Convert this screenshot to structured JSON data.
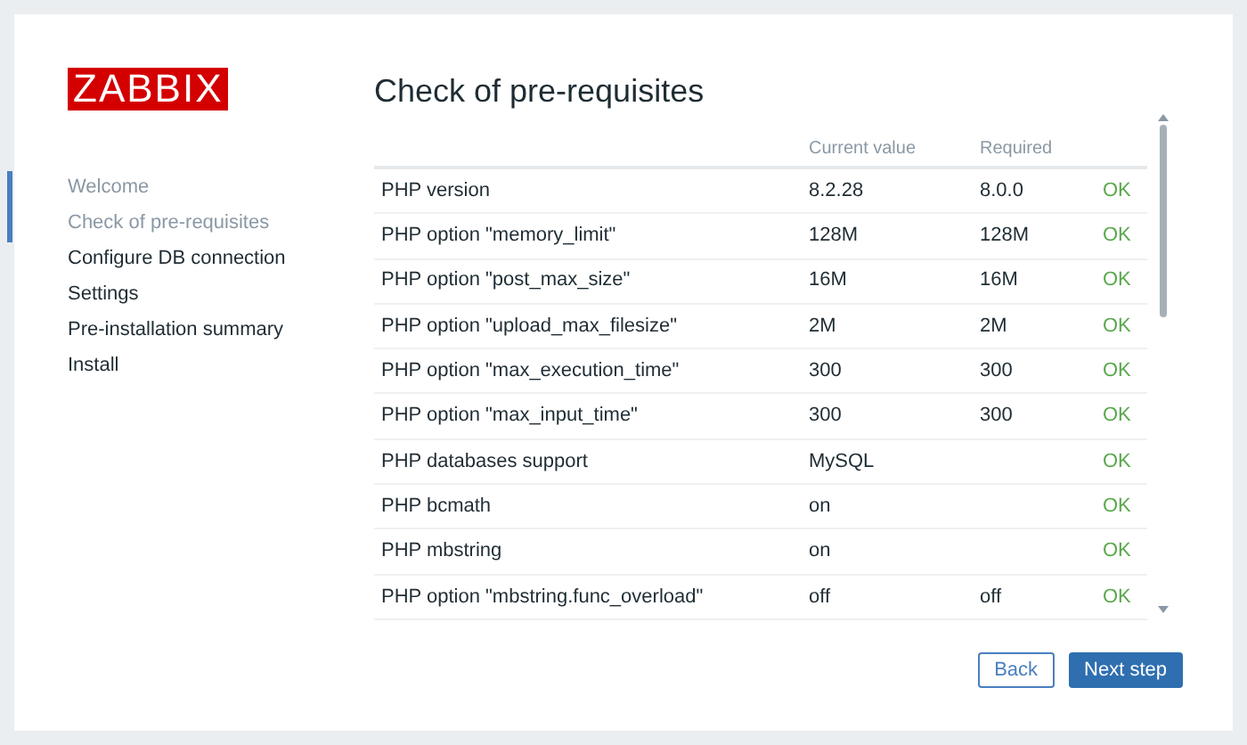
{
  "logo": "ZABBIX",
  "steps": [
    {
      "label": "Welcome",
      "visited": true
    },
    {
      "label": "Check of pre-requisites",
      "visited": true
    },
    {
      "label": "Configure DB connection",
      "visited": false
    },
    {
      "label": "Settings",
      "visited": false
    },
    {
      "label": "Pre-installation summary",
      "visited": false
    },
    {
      "label": "Install",
      "visited": false
    }
  ],
  "title": "Check of pre-requisites",
  "table": {
    "columns": [
      "Current value",
      "Required"
    ],
    "rows": [
      {
        "name": "PHP version",
        "current": "8.2.28",
        "required": "8.0.0",
        "status": "OK",
        "ok": true
      },
      {
        "name": "PHP option \"memory_limit\"",
        "current": "128M",
        "required": "128M",
        "status": "OK",
        "ok": true
      },
      {
        "name": "PHP option \"post_max_size\"",
        "current": "16M",
        "required": "16M",
        "status": "OK",
        "ok": true
      },
      {
        "name": "PHP option \"upload_max_filesize\"",
        "current": "2M",
        "required": "2M",
        "status": "OK",
        "ok": true
      },
      {
        "name": "PHP option \"max_execution_time\"",
        "current": "300",
        "required": "300",
        "status": "OK",
        "ok": true
      },
      {
        "name": "PHP option \"max_input_time\"",
        "current": "300",
        "required": "300",
        "status": "OK",
        "ok": true
      },
      {
        "name": "PHP databases support",
        "current": "MySQL",
        "status": "OK",
        "ok": true
      },
      {
        "name": "PHP bcmath",
        "current": "on",
        "status": "OK",
        "ok": true
      },
      {
        "name": "PHP mbstring",
        "current": "on",
        "status": "OK",
        "ok": true
      },
      {
        "name": "PHP option \"mbstring.func_overload\"",
        "current": "off",
        "required": "off",
        "status": "OK",
        "ok": true
      }
    ]
  },
  "buttons": {
    "back": "Back",
    "next": "Next step"
  }
}
